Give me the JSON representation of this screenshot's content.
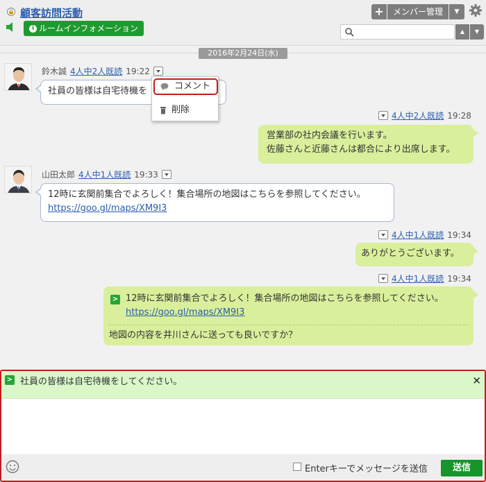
{
  "header": {
    "room_title": "顧客訪問活動",
    "room_info_label": "ルームインフォメーション",
    "member_button_label": "メンバー管理",
    "search_placeholder": ""
  },
  "date_separator": "2016年2月24日(水)",
  "messages": [
    {
      "author": "鈴木誠",
      "read_status": "4人中2人既読",
      "time": "19:22",
      "text": "社員の皆様は自宅待機を"
    },
    {
      "read_status": "4人中2人既読",
      "time": "19:28",
      "line1": "営業部の社内会議を行います。",
      "line2": "佐藤さんと近藤さんは都合により出席します。"
    },
    {
      "author": "山田太郎",
      "read_status": "4人中1人既読",
      "time": "19:33",
      "text": "12時に玄関前集合でよろしく！集合場所の地図はこちらを参照してください。",
      "link": "https://goo.gl/maps/XM9I3"
    },
    {
      "read_status": "4人中1人既読",
      "time": "19:34",
      "text": "ありがとうございます。"
    },
    {
      "read_status": "4人中1人既読",
      "time": "19:34",
      "quote_text": "12時に玄関前集合でよろしく！集合場所の地図はこちらを参照してください。",
      "quote_link": "https://goo.gl/maps/XM9I3",
      "text": "地図の内容を井川さんに送っても良いですか？"
    }
  ],
  "context_menu": {
    "comment_label": "コメント",
    "delete_label": "削除"
  },
  "composer": {
    "reply_text": "社員の皆様は自宅待機をしてください。",
    "enter_label": "Enterキーでメッセージを送信",
    "send_label": "送信"
  },
  "colors": {
    "accent_green": "#1f9a2f",
    "outgoing_bubble": "#d9ef9b",
    "highlight_red": "#c41b1b"
  }
}
